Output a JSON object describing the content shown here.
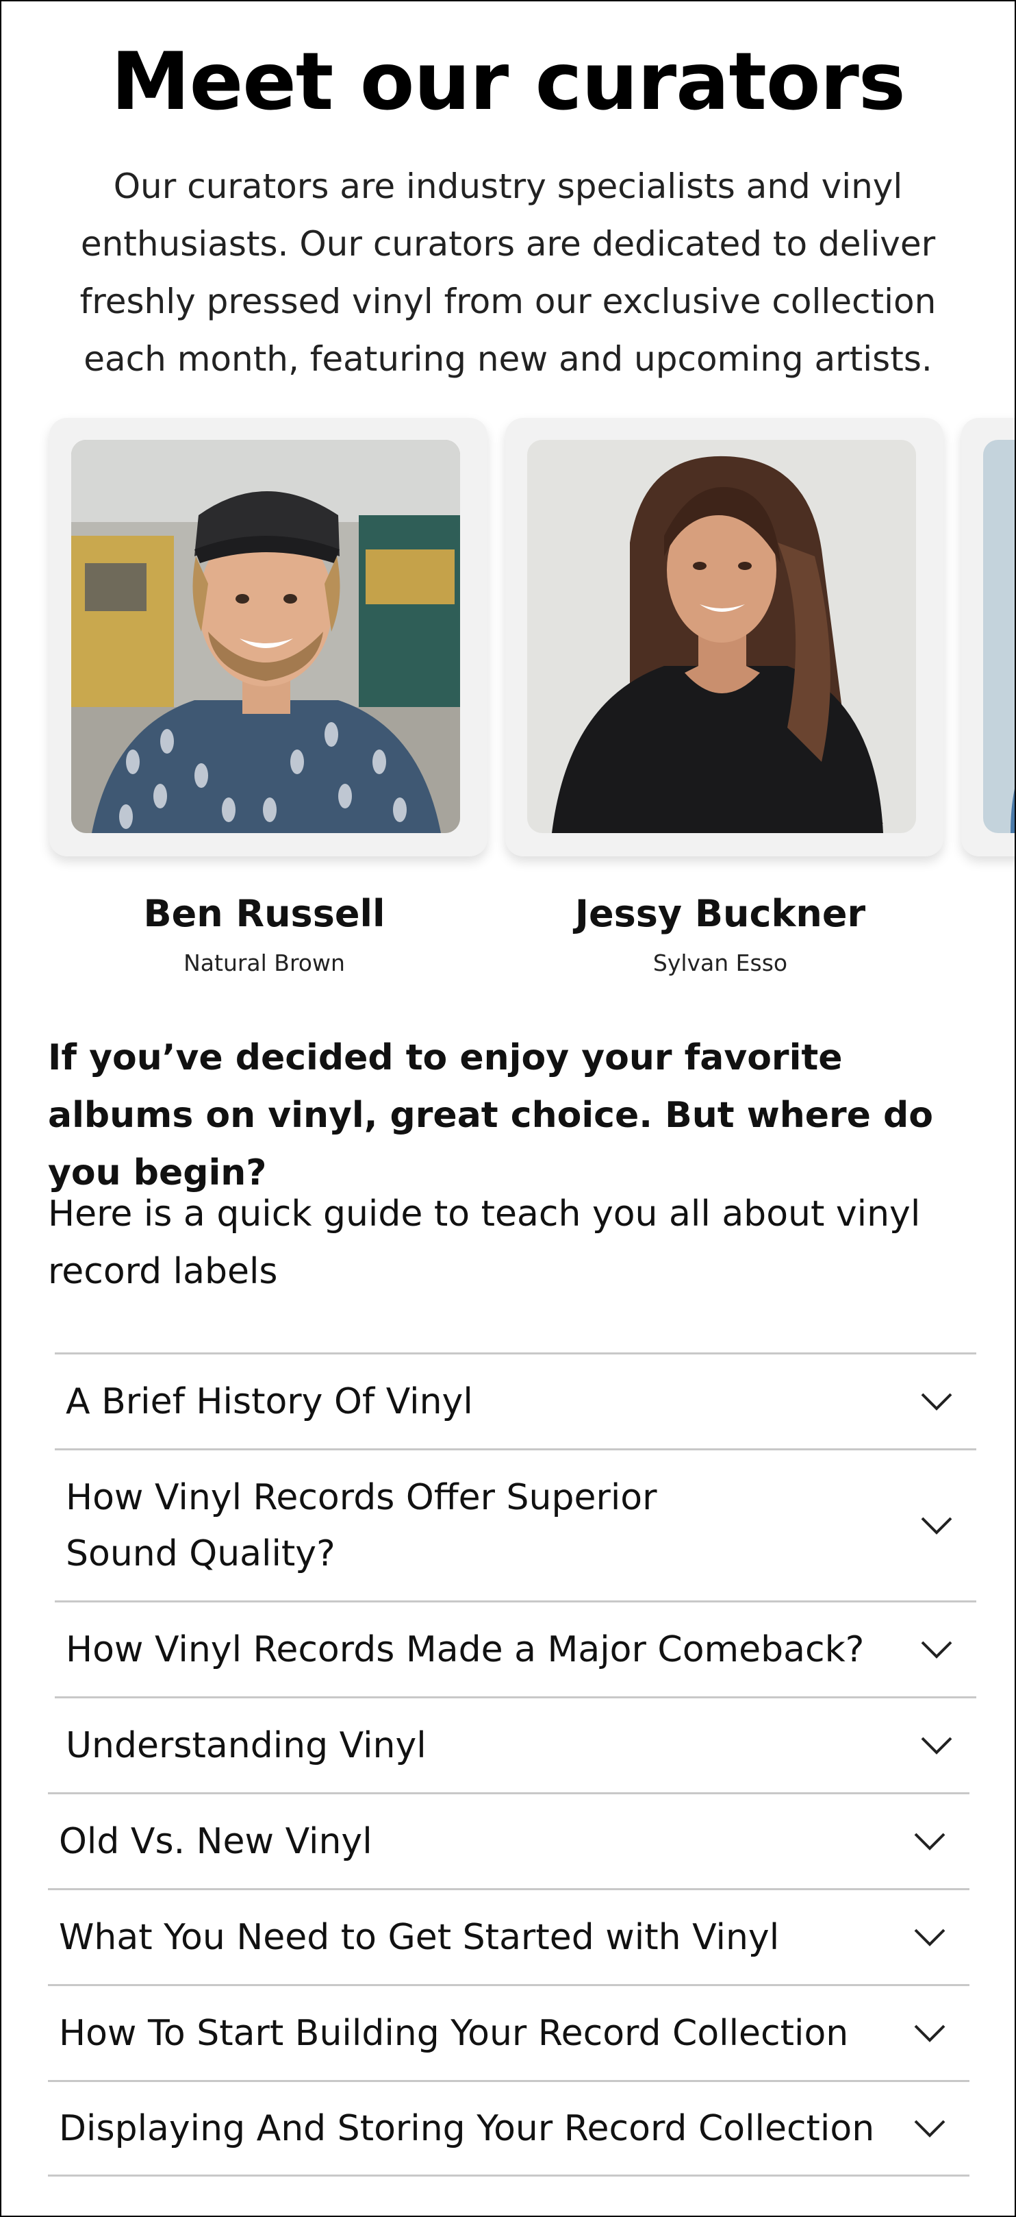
{
  "page": {
    "title": "Meet our curators",
    "intro": "Our curators are industry specialists and vinyl enthusiasts. Our curators are dedicated to deliver freshly pressed vinyl from our exclusive collection each month, featuring new and upcoming artists."
  },
  "curators": [
    {
      "name": "Ben Russell",
      "artist": "Natural Brown"
    },
    {
      "name": "Jessy Buckner",
      "artist": "Sylvan Esso"
    }
  ],
  "guide": {
    "lead": "If you’ve decided to enjoy your favorite albums on vinyl, great choice. But where do you begin?",
    "description": "Here is a quick guide to teach you all about vinyl record labels"
  },
  "faq": [
    {
      "label": "A Brief History Of Vinyl",
      "icon": "chevron-down-icon"
    },
    {
      "label": "How Vinyl Records Offer Superior Sound Quality?",
      "icon": "chevron-down-icon"
    },
    {
      "label": "How Vinyl Records Made a Major Comeback?",
      "icon": "chevron-down-icon"
    },
    {
      "label": "Understanding Vinyl",
      "icon": "chevron-down-icon"
    },
    {
      "label": "Old Vs. New Vinyl",
      "icon": "chevron-down-icon"
    },
    {
      "label": "What You Need to Get Started with Vinyl",
      "icon": "chevron-down-icon"
    },
    {
      "label": "How To Start Building Your Record Collection",
      "icon": "chevron-down-icon"
    },
    {
      "label": "Displaying And Storing Your Record Collection",
      "icon": "chevron-down-icon"
    }
  ],
  "colors": {
    "divider": "#c8c8c8",
    "card_bg": "#f2f2f2",
    "text": "#111111"
  }
}
